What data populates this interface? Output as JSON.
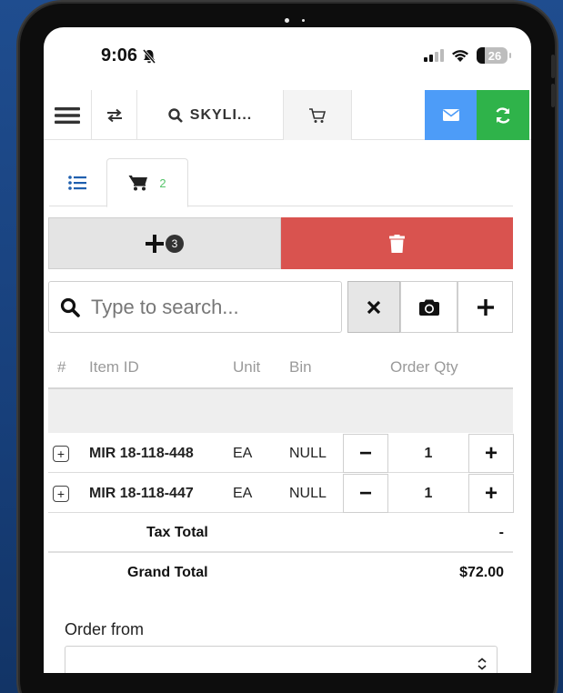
{
  "status_bar": {
    "time": "9:06",
    "battery": "26"
  },
  "toolbar": {
    "search_label": "SKYLI..."
  },
  "tabs": {
    "cart_count": "2"
  },
  "actions": {
    "add_badge": "3"
  },
  "search": {
    "placeholder": "Type to search..."
  },
  "table": {
    "headers": [
      "#",
      "Item ID",
      "Unit",
      "Bin",
      "Order Qty"
    ],
    "rows": [
      {
        "item_id": "MIR 18-118-448",
        "unit": "EA",
        "bin": "NULL",
        "qty": "1"
      },
      {
        "item_id": "MIR 18-118-447",
        "unit": "EA",
        "bin": "NULL",
        "qty": "1"
      }
    ]
  },
  "totals": {
    "tax_label": "Tax Total",
    "tax_value": "-",
    "grand_label": "Grand Total",
    "grand_value": "$72.00"
  },
  "order_from": {
    "label": "Order from",
    "selected": ""
  },
  "colors": {
    "mail": "#4d9cf8",
    "sync": "#2fb34a",
    "delete": "#d9534f",
    "badge_green": "#56c46a",
    "list_blue": "#1f5fae"
  },
  "icons": [
    "mute-bell-icon",
    "signal-icon",
    "wifi-icon",
    "battery-icon",
    "hamburger-icon",
    "swap-icon",
    "search-icon",
    "cart-icon",
    "mail-icon",
    "sync-icon",
    "list-icon",
    "plus-icon",
    "trash-icon",
    "close-icon",
    "camera-icon",
    "minus-icon",
    "expand-plus-icon",
    "chevron-updown-icon"
  ]
}
